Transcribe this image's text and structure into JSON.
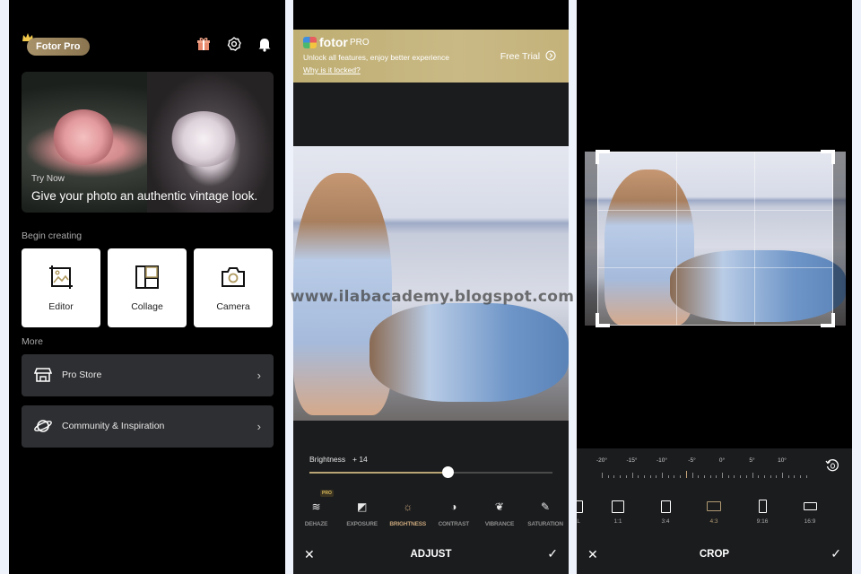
{
  "watermark": "www.ilabacademy.blogspot.com",
  "home": {
    "badge": "Fotor Pro",
    "top_icons": [
      "gift-icon",
      "settings-icon",
      "bell-icon"
    ],
    "hero": {
      "kicker": "Try Now",
      "headline": "Give your photo an authentic vintage look."
    },
    "begin_label": "Begin creating",
    "tiles": [
      {
        "label": "Editor",
        "icon": "crop-image-icon"
      },
      {
        "label": "Collage",
        "icon": "collage-icon"
      },
      {
        "label": "Camera",
        "icon": "camera-icon"
      }
    ],
    "more_label": "More",
    "more_items": [
      {
        "label": "Pro Store",
        "icon": "store-icon"
      },
      {
        "label": "Community & Inspiration",
        "icon": "planet-icon"
      }
    ],
    "chevron": "›"
  },
  "adjust": {
    "banner": {
      "brand": "fotor",
      "pro": "PRO",
      "subtitle": "Unlock all features, enjoy better experience",
      "link": "Why is it locked?",
      "cta": "Free Trial"
    },
    "slider": {
      "label": "Brightness",
      "value_text": "+ 14",
      "fraction": 0.57
    },
    "tools": [
      {
        "label": "DEHAZE",
        "icon": "dehaze-icon",
        "glyph": "≋",
        "pro": "PRO"
      },
      {
        "label": "EXPOSURE",
        "icon": "exposure-icon",
        "glyph": "◩"
      },
      {
        "label": "BRIGHTNESS",
        "icon": "brightness-icon",
        "glyph": "☼",
        "active": true
      },
      {
        "label": "CONTRAST",
        "icon": "contrast-icon",
        "glyph": "◑"
      },
      {
        "label": "VIBRANCE",
        "icon": "leaf-icon",
        "glyph": "❦"
      },
      {
        "label": "SATURATION",
        "icon": "dropper-icon",
        "glyph": "✎"
      }
    ],
    "bottom": {
      "cancel": "✕",
      "title": "ADJUST",
      "confirm": "✓"
    }
  },
  "crop": {
    "ruler_labels": [
      "-20°",
      "-15°",
      "-10°",
      "-5°",
      "0°",
      "5°",
      "10°"
    ],
    "ratios": [
      {
        "label": "AL"
      },
      {
        "label": "1:1"
      },
      {
        "label": "3:4"
      },
      {
        "label": "4:3",
        "active": true
      },
      {
        "label": "9:16"
      },
      {
        "label": "16:9"
      }
    ],
    "bottom": {
      "cancel": "✕",
      "title": "CROP",
      "confirm": "✓"
    }
  },
  "colors": {
    "accent_gold": "#c6a57b",
    "banner_gold": "#c4b27a",
    "panel_dark": "#1b1c1e",
    "row_dark": "#2e2f32"
  }
}
